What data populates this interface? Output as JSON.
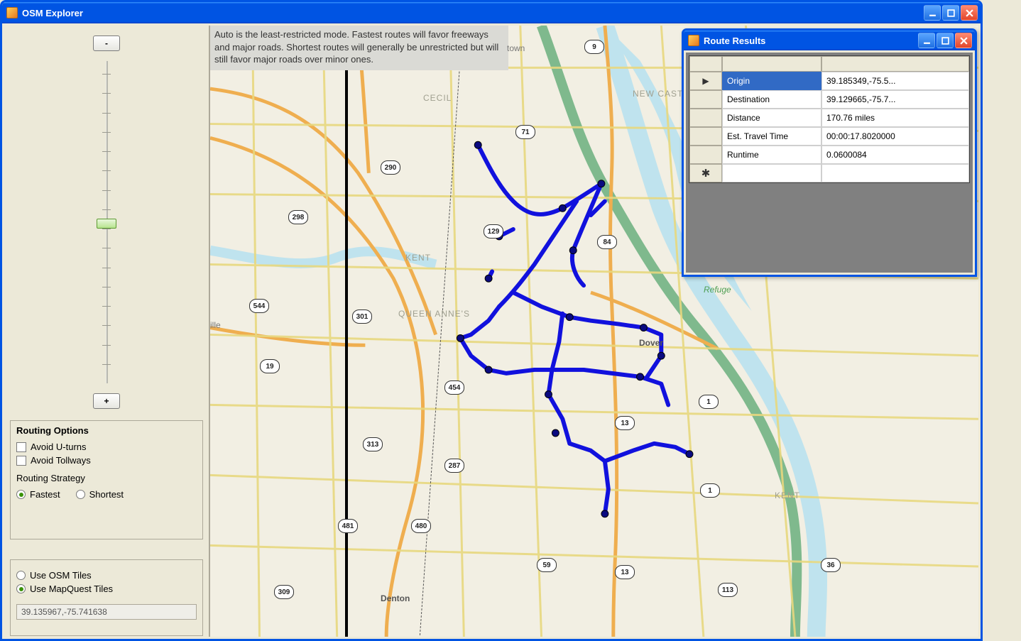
{
  "mainWindow": {
    "title": "OSM Explorer"
  },
  "zoom": {
    "minusLabel": "-",
    "plusLabel": "+"
  },
  "routingOptions": {
    "legend": "Routing Options",
    "avoidUturns": "Avoid U-turns",
    "avoidTollways": "Avoid Tollways",
    "strategyLabel": "Routing Strategy",
    "fastest": "Fastest",
    "shortest": "Shortest"
  },
  "tiles": {
    "osm": "Use OSM Tiles",
    "mapquest": "Use MapQuest Tiles"
  },
  "coordField": "39.135967,-75.741638",
  "infoBox": "Auto is the least-restricted mode. Fastest routes will favor freeways and major roads. Shortest routes will generally be unrestricted but will still favor major roads over minor ones.",
  "mapLabels": {
    "cecil": "CECIL",
    "kent": "KENT",
    "queenAnnes": "QUEEN ANNE'S",
    "kent2": "KENT",
    "newcastle": "NEW CASTLE",
    "dover": "Dover",
    "denton": "Denton",
    "ille": "ille",
    "town": "town",
    "refuge": "Refuge"
  },
  "shields": {
    "s9": "9",
    "s71": "71",
    "s290": "290",
    "s298": "298",
    "s129": "129",
    "s84": "84",
    "s544": "544",
    "s301": "301",
    "s19": "19",
    "s454": "454",
    "s313": "313",
    "s287": "287",
    "s481": "481",
    "s480": "480",
    "s309": "309",
    "s59": "59",
    "s13": "13",
    "s1a": "1",
    "s1b": "1",
    "s36": "36",
    "s113": "113"
  },
  "resultsWindow": {
    "title": "Route Results",
    "rows": [
      {
        "label": "Origin",
        "value": "39.185349,-75.5..."
      },
      {
        "label": "Destination",
        "value": "39.129665,-75.7..."
      },
      {
        "label": "Distance",
        "value": "170.76 miles"
      },
      {
        "label": "Est. Travel Time",
        "value": "00:00:17.8020000"
      },
      {
        "label": "Runtime",
        "value": "0.0600084"
      }
    ]
  }
}
